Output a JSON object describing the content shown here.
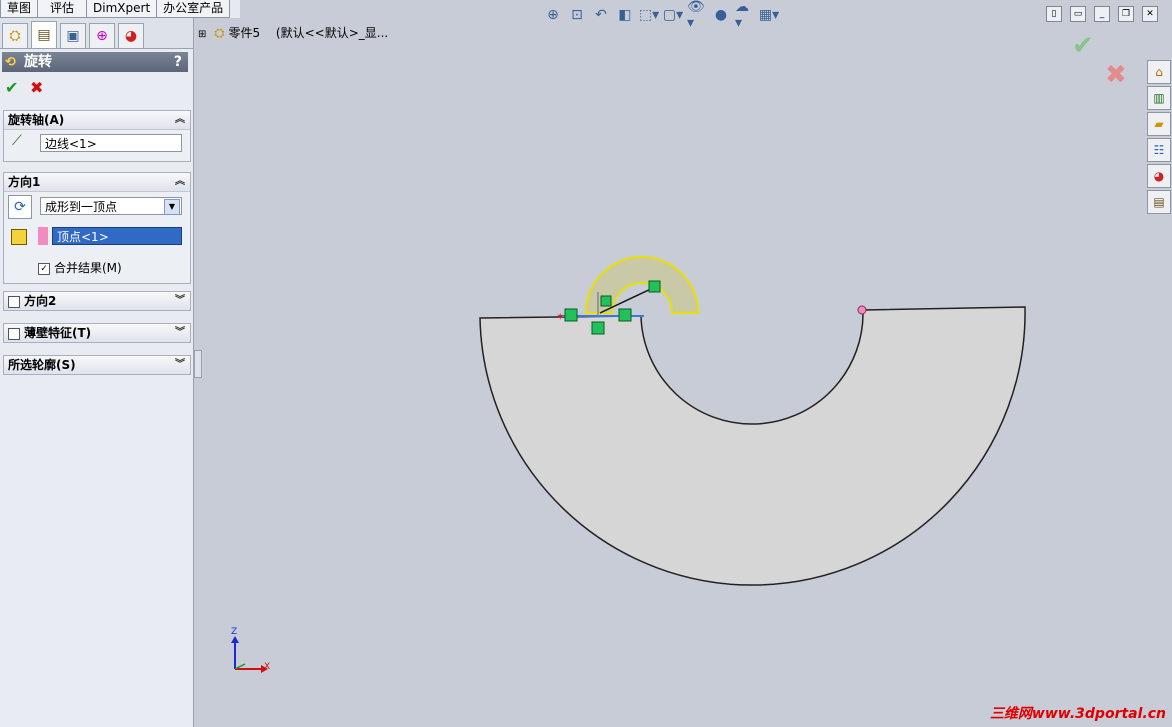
{
  "command_tabs": [
    "草图",
    "评估",
    "DimXpert",
    "办公室产品"
  ],
  "property_manager": {
    "title": "旋转",
    "help": "?",
    "ok": "✔",
    "cancel": "✖",
    "axis_section": {
      "label": "旋转轴(A)",
      "value": "边线<1>"
    },
    "direction1": {
      "label": "方向1",
      "end_condition": "成形到一顶点",
      "vertex": "顶点<1>",
      "merge_label": "合并结果(M)",
      "merge_checked": true
    },
    "direction2": {
      "label": "方向2"
    },
    "thin_feature": {
      "label": "薄壁特征(T)"
    },
    "selected_contours": {
      "label": "所选轮廓(S)"
    }
  },
  "tree": {
    "part": "零件5",
    "config": "(默认<<默认>_显..."
  },
  "triad": {
    "z": "Z",
    "x": "X"
  },
  "watermark": "三维网www.3dportal.cn",
  "colors": {
    "accent": "#316ac5",
    "selection_yellow": "#e8e000",
    "sketch_green": "#22c25a"
  }
}
